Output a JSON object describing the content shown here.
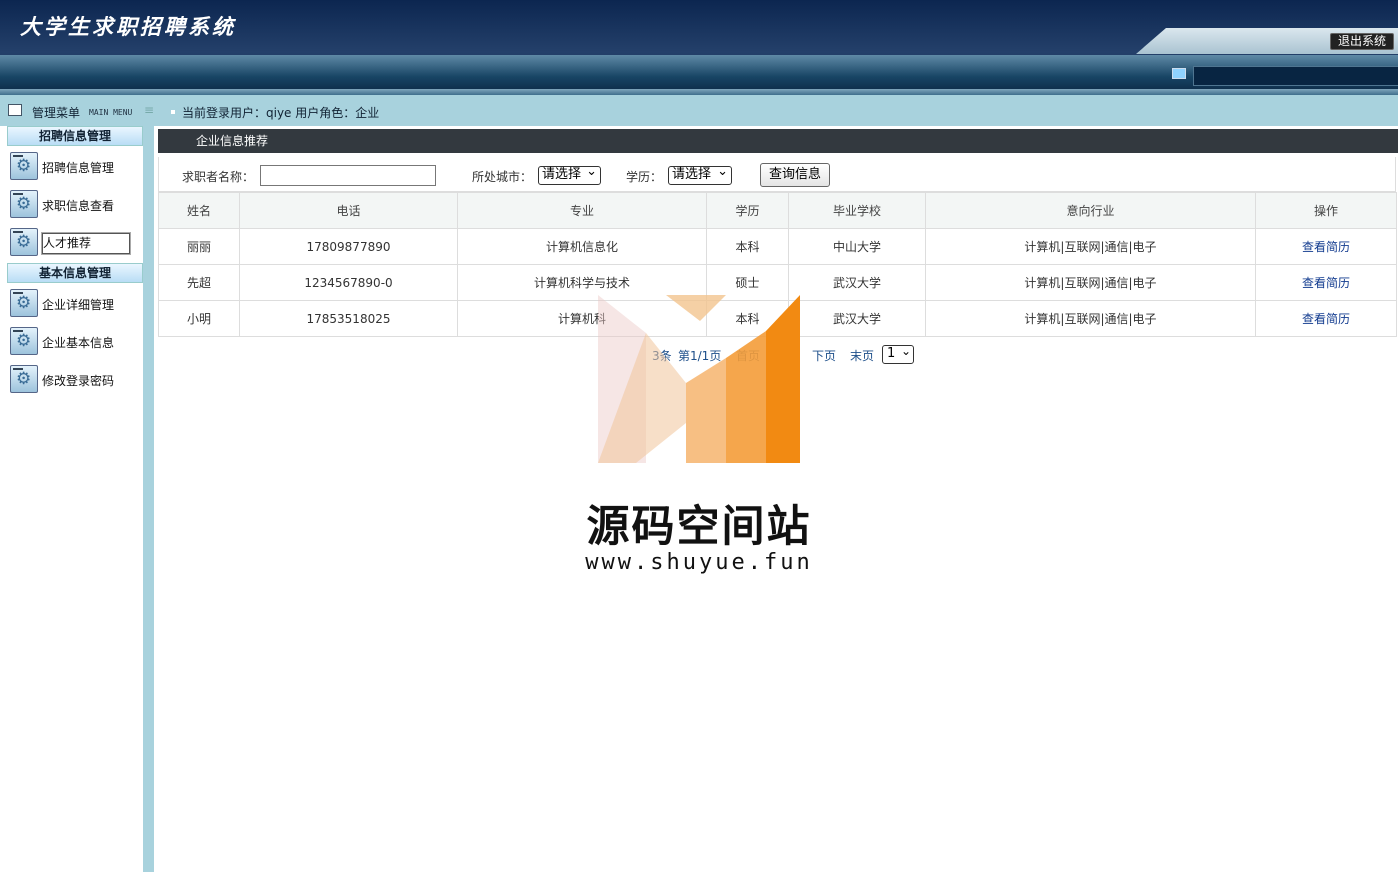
{
  "app": {
    "title": "大学生求职招聘系统",
    "logout_label": "退出系统"
  },
  "menu": {
    "title": "管理菜单",
    "subtitle": "MAIN MENU"
  },
  "session": {
    "user_info": "当前登录用户：qiye  用户角色：企业"
  },
  "sidebar": {
    "groups": [
      {
        "label": "招聘信息管理",
        "items": [
          {
            "label": "招聘信息管理"
          },
          {
            "label": "求职信息查看"
          },
          {
            "label": "人才推荐",
            "active": true
          }
        ]
      },
      {
        "label": "基本信息管理",
        "items": [
          {
            "label": "企业详细管理"
          },
          {
            "label": "企业基本信息"
          },
          {
            "label": "修改登录密码"
          }
        ]
      }
    ]
  },
  "panel": {
    "title": "企业信息推荐"
  },
  "search": {
    "name_label": "求职者名称：",
    "name_value": "",
    "city_label": "所处城市：",
    "city_selected": "请选择",
    "edu_label": "学历：",
    "edu_selected": "请选择",
    "query_label": "查询信息"
  },
  "table": {
    "columns": [
      "姓名",
      "电话",
      "专业",
      "学历",
      "毕业学校",
      "意向行业",
      "操作"
    ],
    "rows": [
      {
        "name": "丽丽",
        "phone": "17809877890",
        "major": "计算机信息化",
        "edu": "本科",
        "school": "中山大学",
        "industry": "计算机|互联网|通信|电子",
        "action": "查看简历"
      },
      {
        "name": "先超",
        "phone": "1234567890-0",
        "major": "计算机科学与技术",
        "edu": "硕士",
        "school": "武汉大学",
        "industry": "计算机|互联网|通信|电子",
        "action": "查看简历"
      },
      {
        "name": "小明",
        "phone": "17853518025",
        "major": "计算机科",
        "edu": "本科",
        "school": "武汉大学",
        "industry": "计算机|互联网|通信|电子",
        "action": "查看简历"
      }
    ]
  },
  "pager": {
    "count": "3条",
    "page": "第1/1页",
    "first": "首页",
    "next": "下页",
    "last": "末页",
    "selected": "1"
  },
  "watermark": {
    "text": "源码空间站",
    "url": "www.shuyue.fun"
  },
  "colors": {
    "header": "#0c2650",
    "subbar": "#a8d2dd",
    "panel_head": "#33393f",
    "link": "#123b8f",
    "watermark_orange": "#f28a12"
  }
}
